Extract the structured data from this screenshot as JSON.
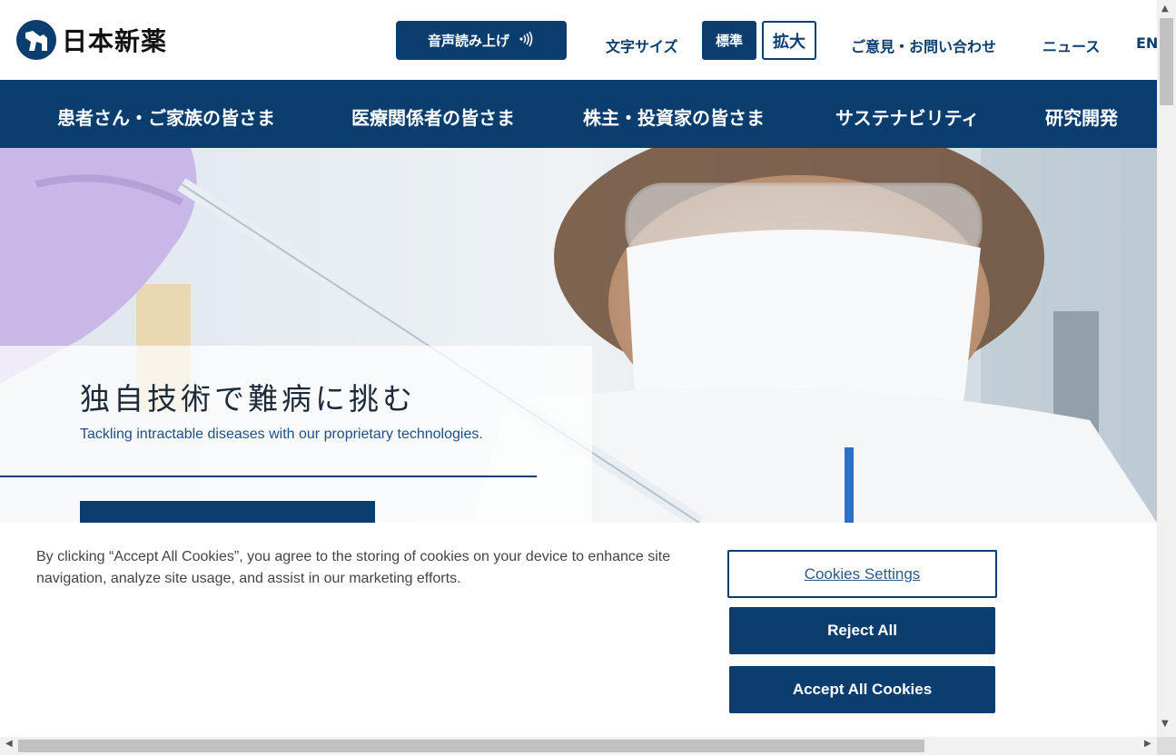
{
  "header": {
    "logo_text": "日本新薬",
    "voice_button": "音声読み上げ",
    "font_size_label": "文字サイズ",
    "font_size_standard": "標準",
    "font_size_large": "拡大",
    "links": {
      "contact": "ご意見・お問い合わせ",
      "news": "ニュース",
      "english": "EN"
    }
  },
  "nav": {
    "items": [
      {
        "label": "患者さん・ご家族の皆さま"
      },
      {
        "label": "医療関係者の皆さま"
      },
      {
        "label": "株主・投資家の皆さま"
      },
      {
        "label": "サステナビリティ"
      },
      {
        "label": "研究開発"
      }
    ]
  },
  "hero": {
    "title": "独自技術で難病に挑む",
    "subtitle": "Tackling intractable diseases with our proprietary technologies."
  },
  "cookie_banner": {
    "text": "By clicking “Accept All Cookies”, you agree to the storing of cookies on your device to enhance site navigation, analyze site usage, and assist in our marketing efforts.",
    "settings_button": "Cookies Settings",
    "reject_button": "Reject All",
    "accept_button": "Accept All Cookies"
  },
  "colors": {
    "brand_navy": "#0b3d6e",
    "link_blue": "#1f4f86"
  },
  "icons": {
    "voice": "sound-wave-icon",
    "logo": "logo-mark-icon"
  }
}
